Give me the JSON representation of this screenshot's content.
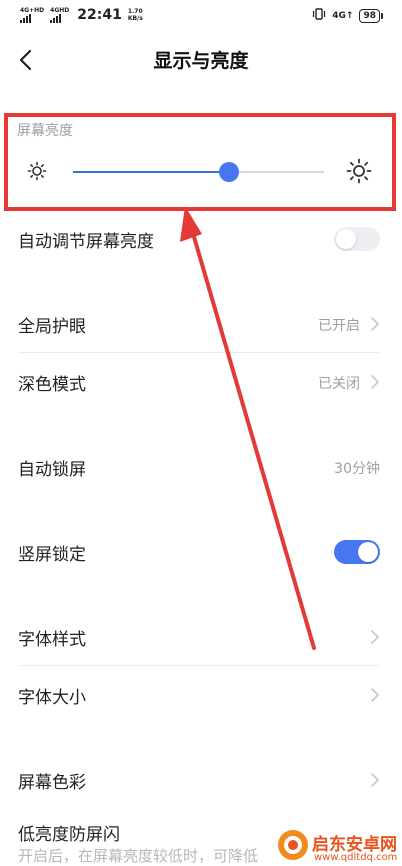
{
  "status_bar": {
    "network_1": "4G+HD",
    "network_2": "4GHD",
    "time": "22:41",
    "speed_value": "1.70",
    "speed_unit": "KB/s",
    "signal_right": "4G↑",
    "battery": "98"
  },
  "header": {
    "title": "显示与亮度"
  },
  "brightness": {
    "label": "屏幕亮度",
    "level_fraction": 0.62
  },
  "rows": {
    "auto_brightness": {
      "label": "自动调节屏幕亮度",
      "enabled": false
    },
    "eye_protection": {
      "label": "全局护眼",
      "value": "已开启"
    },
    "dark_mode": {
      "label": "深色模式",
      "value": "已关闭"
    },
    "auto_lock": {
      "label": "自动锁屏",
      "value": "30分钟"
    },
    "portrait_lock": {
      "label": "竖屏锁定",
      "enabled": true
    },
    "font_style": {
      "label": "字体样式"
    },
    "font_size": {
      "label": "字体大小"
    },
    "screen_color": {
      "label": "屏幕色彩"
    },
    "low_brightness_flicker": {
      "label": "低亮度防屏闪",
      "hint": "开启后，在屏幕亮度较低时，可降低"
    }
  },
  "watermark": {
    "name": "启东安卓网",
    "url": "www.qdltdq.com"
  },
  "colors": {
    "accent": "#4777ef",
    "highlight": "#e53935",
    "watermark": "#e8541c"
  },
  "icons": {
    "back": "chevron-left-icon",
    "brightness_low": "sun-small-icon",
    "brightness_high": "sun-large-icon",
    "chevron": "chevron-right-icon"
  }
}
